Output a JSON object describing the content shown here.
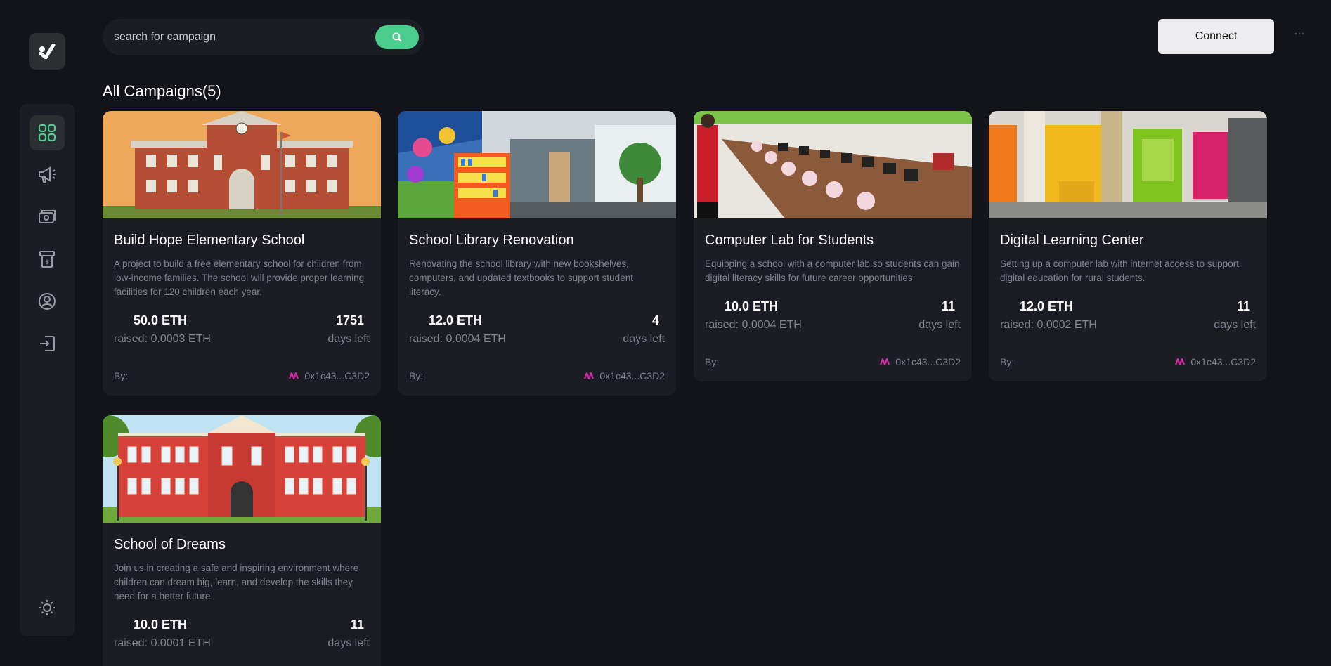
{
  "search": {
    "placeholder": "search for campaign"
  },
  "header": {
    "connect_label": "Connect",
    "more_label": "···"
  },
  "page": {
    "heading": "All Campaigns(5)"
  },
  "sidebar": {
    "items": [
      {
        "icon": "dashboard-icon",
        "active": true
      },
      {
        "icon": "megaphone-icon",
        "active": false
      },
      {
        "icon": "payment-icon",
        "active": false
      },
      {
        "icon": "withdraw-icon",
        "active": false
      },
      {
        "icon": "profile-icon",
        "active": false
      },
      {
        "icon": "logout-icon",
        "active": false
      }
    ],
    "theme_icon": "sun-icon"
  },
  "campaigns": [
    {
      "title": "Build Hope Elementary School",
      "description": "A project to build a free elementary school for children from low-income families. The school will provide proper learning facilities for 120 children each year.",
      "target": "50.0 ETH",
      "raised": "raised: 0.0003 ETH",
      "days": "1751",
      "days_label": "days left",
      "by_label": "By:",
      "owner": "0x1c43...C3D2"
    },
    {
      "title": "School Library Renovation",
      "description": "Renovating the school library with new bookshelves, computers, and updated textbooks to support student literacy.",
      "target": "12.0 ETH",
      "raised": "raised: 0.0004 ETH",
      "days": "4",
      "days_label": "days left",
      "by_label": "By:",
      "owner": "0x1c43...C3D2"
    },
    {
      "title": "Computer Lab for Students",
      "description": "Equipping a school with a computer lab so students can gain digital literacy skills for future career opportunities.",
      "target": "10.0 ETH",
      "raised": "raised: 0.0004 ETH",
      "days": "11",
      "days_label": "days left",
      "by_label": "By:",
      "owner": "0x1c43...C3D2"
    },
    {
      "title": "Digital Learning Center",
      "description": "Setting up a computer lab with internet access to support digital education for rural students.",
      "target": "12.0 ETH",
      "raised": "raised: 0.0002 ETH",
      "days": "11",
      "days_label": "days left",
      "by_label": "By:",
      "owner": "0x1c43...C3D2"
    },
    {
      "title": "School of Dreams",
      "description": "Join us in creating a safe and inspiring environment where children can dream big, learn, and develop the skills they need for a better future.",
      "target": "10.0 ETH",
      "raised": "raised: 0.0001 ETH",
      "days": "11",
      "days_label": "days left"
    }
  ],
  "colors": {
    "accent": "#4acd8d",
    "background": "#13131a",
    "card": "#1c1c24",
    "muted": "#808191"
  }
}
